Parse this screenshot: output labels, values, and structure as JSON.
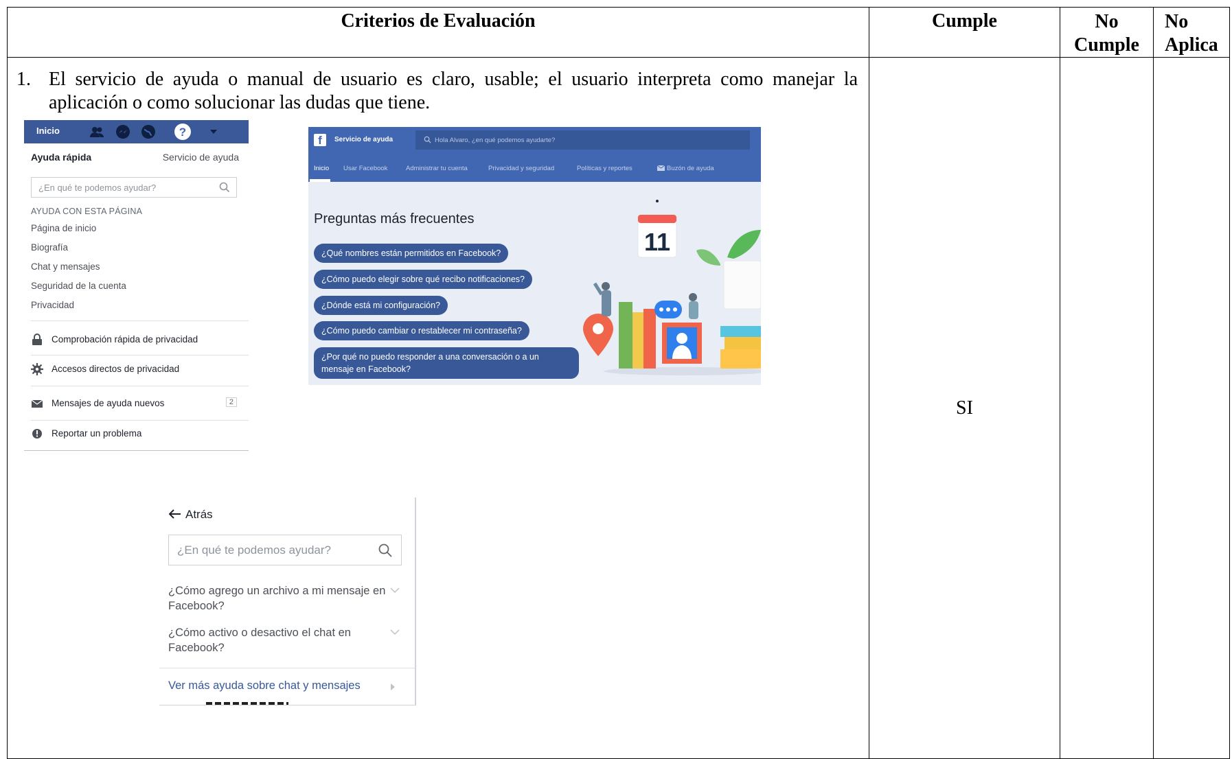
{
  "table": {
    "headers": {
      "criterios": "Criterios de Evaluación",
      "cumple": "Cumple",
      "no_cumple": "No Cumple",
      "no_aplica": "No Aplica"
    },
    "row": {
      "number": "1.",
      "text": "El servicio de ayuda o manual de usuario es claro, usable; el usuario interpreta como manejar la aplicación o como solucionar las dudas que tiene.",
      "cumple_value": "SI",
      "no_cumple_value": "",
      "no_aplica_value": ""
    }
  },
  "quick_help": {
    "topbar_label": "Inicio",
    "title": "Ayuda rápida",
    "service_link": "Servicio de ayuda",
    "search_placeholder": "¿En qué te podemos ayudar?",
    "section_caption": "AYUDA CON ESTA PÁGINA",
    "items": [
      "Página de inicio",
      "Biografía",
      "Chat y mensajes",
      "Seguridad de la cuenta",
      "Privacidad"
    ],
    "actions": {
      "privacy_check": "Comprobación rápida de privacidad",
      "privacy_shortcuts": "Accesos directos de privacidad",
      "help_messages": "Mensajes de ayuda nuevos",
      "help_messages_count": "2",
      "report_problem": "Reportar un problema"
    }
  },
  "help_center": {
    "brand": "Servicio de ayuda",
    "search_placeholder": "Hola Alvaro, ¿en qué podemos ayudarte?",
    "nav": [
      "Inicio",
      "Usar Facebook",
      "Administrar tu cuenta",
      "Privacidad y seguridad",
      "Políticas y reportes",
      "Buzón de ayuda"
    ],
    "title": "Preguntas más frecuentes",
    "faqs": [
      "¿Qué nombres están permitidos en Facebook?",
      "¿Cómo puedo elegir sobre qué recibo notificaciones?",
      "¿Dónde está mi configuración?",
      "¿Cómo puedo cambiar o restablecer mi contraseña?",
      "¿Por qué no puedo responder a una conversación o a un mensaje en Facebook?"
    ],
    "calendar_day": "11",
    "colors": {
      "header": "#4267b2",
      "pill": "#385898",
      "background": "#e9edf5"
    }
  },
  "chat_help": {
    "back_label": "Atrás",
    "search_placeholder": "¿En qué te podemos ayudar?",
    "questions": [
      "¿Cómo agrego un archivo a mi mensaje en Facebook?",
      "¿Cómo activo o desactivo el chat en Facebook?"
    ],
    "more_link": "Ver más ayuda sobre chat y mensajes"
  }
}
